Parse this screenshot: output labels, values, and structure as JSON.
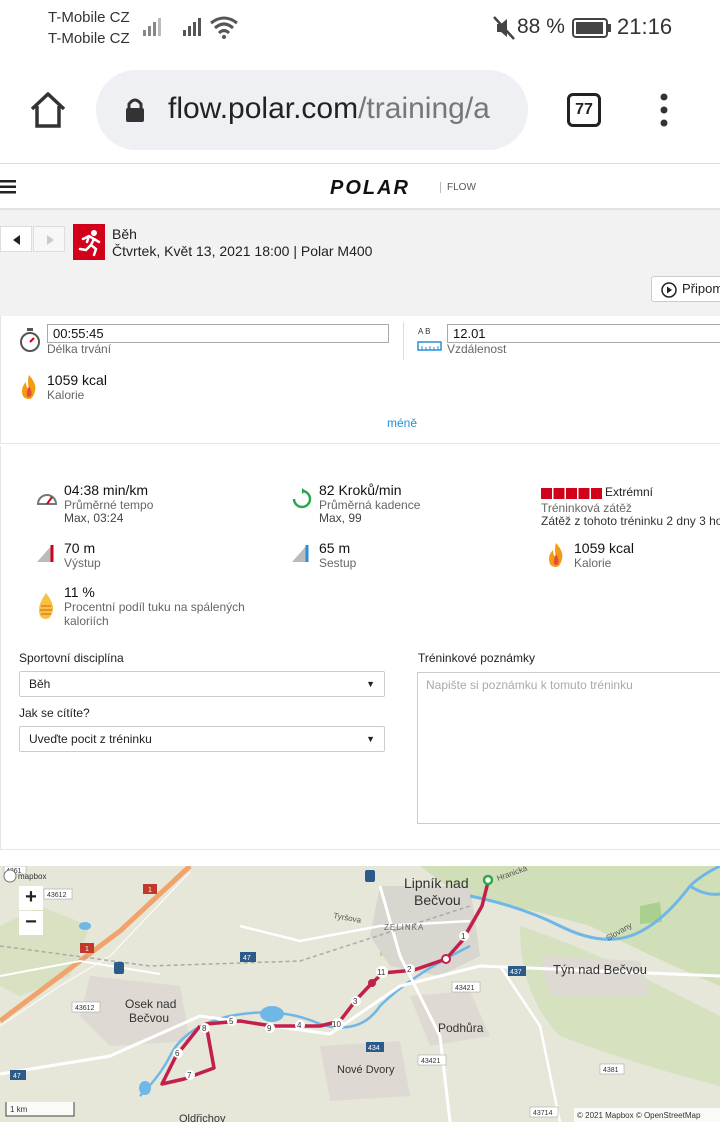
{
  "status": {
    "carrier1": "T-Mobile CZ",
    "carrier2": "T-Mobile CZ",
    "battery": "88 %",
    "time": "21:16"
  },
  "browser": {
    "url_main": "flow.polar.com",
    "url_rest": "/training/a",
    "tabs": "77"
  },
  "header": {
    "logo": "POLAR",
    "product": "FLOW"
  },
  "training": {
    "sport": "Běh",
    "meta": "Čtvrtek, Květ 13, 2021 18:00 | Polar M400",
    "replay": "Připom"
  },
  "summary": {
    "duration_value": "00:55:45",
    "duration_label": "Délka trvání",
    "ab_label": "A B",
    "distance_value": "12.01",
    "distance_label": "Vzdálenost",
    "calories_value": "1059 kcal",
    "calories_label": "Kalorie",
    "less_link": "méně"
  },
  "stats": {
    "pace_value": "04:38 min/km",
    "pace_label": "Průměrné tempo",
    "pace_max": "Max, 03:24",
    "cadence_value": "82 Kroků/min",
    "cadence_label": "Průměrná kadence",
    "cadence_max": "Max, 99",
    "load_value": "Extrémní",
    "load_label": "Tréninková zátěž",
    "load_note": "Zátěž z tohoto tréninku 2 dny 3 ho",
    "ascent_value": "70 m",
    "ascent_label": "Výstup",
    "descent_value": "65 m",
    "descent_label": "Sestup",
    "kcal_value": "1059 kcal",
    "kcal_label": "Kalorie",
    "fat_value": "11 %",
    "fat_label_1": "Procentní podíl tuku na spálených",
    "fat_label_2": "kaloriích"
  },
  "form": {
    "sport_label": "Sportovní disciplína",
    "sport_value": "Běh",
    "feel_label": "Jak se cítíte?",
    "feel_value": "Uveďte pocit z tréninku",
    "notes_label": "Tréninkové poznámky",
    "notes_placeholder": "Napište si poznámku k tomuto tréninku"
  },
  "map": {
    "towns": [
      "Lipník nad",
      "Bečvou",
      "Týn nad Bečvou",
      "Osek nad",
      "Bečvou",
      "Podhůra",
      "Nové Dvory",
      "Oldřichov",
      "ZELINKA"
    ],
    "streets": [
      "Tyršova",
      "Slovany",
      "Hranická"
    ],
    "roads": [
      "43612",
      "43612",
      "1",
      "1",
      "47",
      "47",
      "434",
      "437",
      "43421",
      "43421",
      "43714",
      "4381",
      "4361"
    ],
    "km_markers": [
      "1",
      "2",
      "3",
      "4",
      "5",
      "6",
      "7",
      "8",
      "9",
      "10",
      "11"
    ],
    "scale": "1 km",
    "attribution": "© 2021 Mapbox © OpenStreetMap",
    "mapbox": "mapbox",
    "zoom_in": "+",
    "zoom_out": "−",
    "colors": {
      "route": "#c2204b",
      "river": "#6fb7e6",
      "land": "#e6e6d9"
    }
  }
}
